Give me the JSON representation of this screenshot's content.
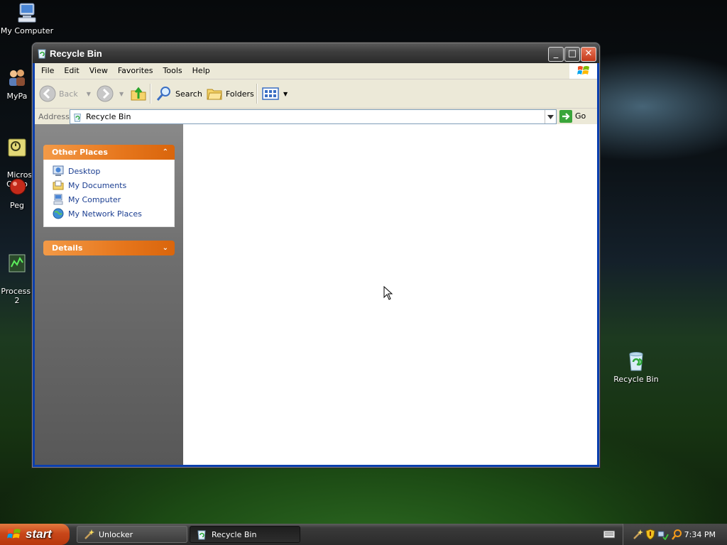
{
  "desktop": {
    "icons": [
      {
        "label": "My Computer"
      },
      {
        "label": "MyPa"
      },
      {
        "label": "Micros\nOutlo"
      },
      {
        "label": "Peg"
      },
      {
        "label": "Process E\n2"
      },
      {
        "label": "Recycle Bin"
      }
    ]
  },
  "window": {
    "title": "Recycle Bin",
    "controls": {
      "minimize": "_",
      "maximize": "□",
      "close": "✕"
    },
    "menu": [
      "File",
      "Edit",
      "View",
      "Favorites",
      "Tools",
      "Help"
    ],
    "toolbar": {
      "back": "Back",
      "search": "Search",
      "folders": "Folders"
    },
    "address": {
      "label": "Address",
      "value": "Recycle Bin",
      "go": "Go"
    },
    "tasks": {
      "other_places": {
        "title": "Other Places",
        "items": [
          {
            "label": "Desktop",
            "icon": "desktop-icon"
          },
          {
            "label": "My Documents",
            "icon": "my-documents-icon"
          },
          {
            "label": "My Computer",
            "icon": "my-computer-icon"
          },
          {
            "label": "My Network Places",
            "icon": "network-places-icon"
          }
        ]
      },
      "details": {
        "title": "Details"
      }
    }
  },
  "taskbar": {
    "start": "start",
    "tasks": [
      {
        "label": "Unlocker"
      },
      {
        "label": "Recycle Bin"
      }
    ],
    "clock": "7:34 PM"
  },
  "colors": {
    "accent_orange": "#e6761c",
    "link_blue": "#1b3e91",
    "title_gray": "#3e3e3e"
  }
}
